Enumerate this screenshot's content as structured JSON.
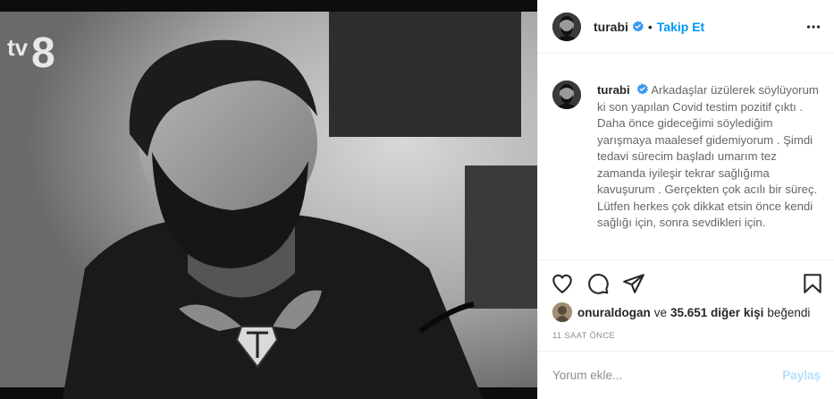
{
  "post": {
    "media": {
      "channel_logo": "tv8",
      "description_icon": "photo-black-white"
    }
  },
  "header": {
    "username": "turabi",
    "separator": "•",
    "follow_label": "Takip Et",
    "more_icon": "more-horizontal-icon",
    "verified_icon": "verified-badge-icon"
  },
  "caption": {
    "username": "turabi",
    "text": "Arkadaşlar üzülerek söylüyorum ki son yapılan Covid testim pozitif çıktı . Daha önce gideceğimi söylediğim yarışmaya maalesef gidemiyorum . Şimdi tedavi sürecim başladı umarım tez zamanda iyileşir tekrar sağlığıma kavuşurum . Gerçekten çok acılı bir süreç. Lütfen herkes çok dikkat etsin önce kendi sağlığı için, sonra sevdikleri için."
  },
  "actions": {
    "like_icon": "heart-icon",
    "comment_icon": "comment-icon",
    "share_icon": "share-icon",
    "save_icon": "bookmark-icon"
  },
  "likes": {
    "first_user": "onuraldogan",
    "connector": "ve",
    "count_text": "35.651 diğer kişi",
    "suffix": "beğendi"
  },
  "timestamp": "11 SAAT ÖNCE",
  "comment": {
    "placeholder": "Yorum ekle...",
    "post_label": "Paylaş"
  },
  "colors": {
    "accent": "#0095f6",
    "post_disabled": "#b2dffc",
    "verified": "#3897f0",
    "border": "#efefef"
  }
}
